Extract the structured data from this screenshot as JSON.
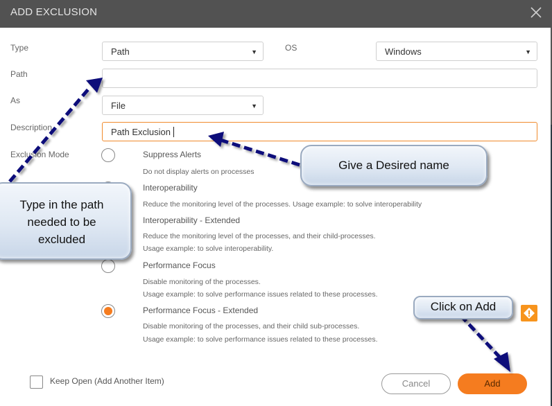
{
  "dialog": {
    "title": "ADD EXCLUSION",
    "close_icon": "close-icon"
  },
  "form": {
    "type": {
      "label": "Type",
      "value": "Path"
    },
    "os": {
      "label": "OS",
      "value": "Windows"
    },
    "path": {
      "label": "Path",
      "value": ""
    },
    "as": {
      "label": "As",
      "value": "File"
    },
    "description": {
      "label": "Description",
      "value": "Path Exclusion"
    },
    "exclusion_mode": {
      "label": "Exclusion Mode",
      "selected": "Performance Focus - Extended",
      "options": [
        {
          "title": "Suppress Alerts",
          "desc": [
            "Do not display alerts on processes"
          ]
        },
        {
          "title": "Interoperability",
          "desc": [
            "Reduce the monitoring level of the processes. Usage example: to solve interoperability"
          ]
        },
        {
          "title": "Interoperability - Extended",
          "desc": [
            "Reduce the monitoring level of the processes, and their child-processes.",
            "Usage example: to solve interoperability."
          ]
        },
        {
          "title": "Performance Focus",
          "desc": [
            "Disable monitoring of the processes.",
            "Usage example: to solve performance issues related to these processes."
          ]
        },
        {
          "title": "Performance Focus - Extended",
          "desc": [
            "Disable monitoring of the processes, and their child sub-processes.",
            "Usage example: to solve performance issues related to these processes."
          ]
        }
      ]
    },
    "warning_icon": "warning-icon"
  },
  "footer": {
    "keep_open": {
      "label": "Keep Open (Add Another Item)",
      "checked": false
    },
    "cancel_label": "Cancel",
    "add_label": "Add"
  },
  "annotations": {
    "desc_callout": "Give a Desired name",
    "path_callout": [
      "Type in the path",
      "needed to be",
      "excluded"
    ],
    "add_callout": "Click on Add",
    "arrow_color": "#0a0a7a"
  },
  "colors": {
    "titlebar": "#525252",
    "accent": "#f57c1f",
    "warning": "#f7941d"
  }
}
